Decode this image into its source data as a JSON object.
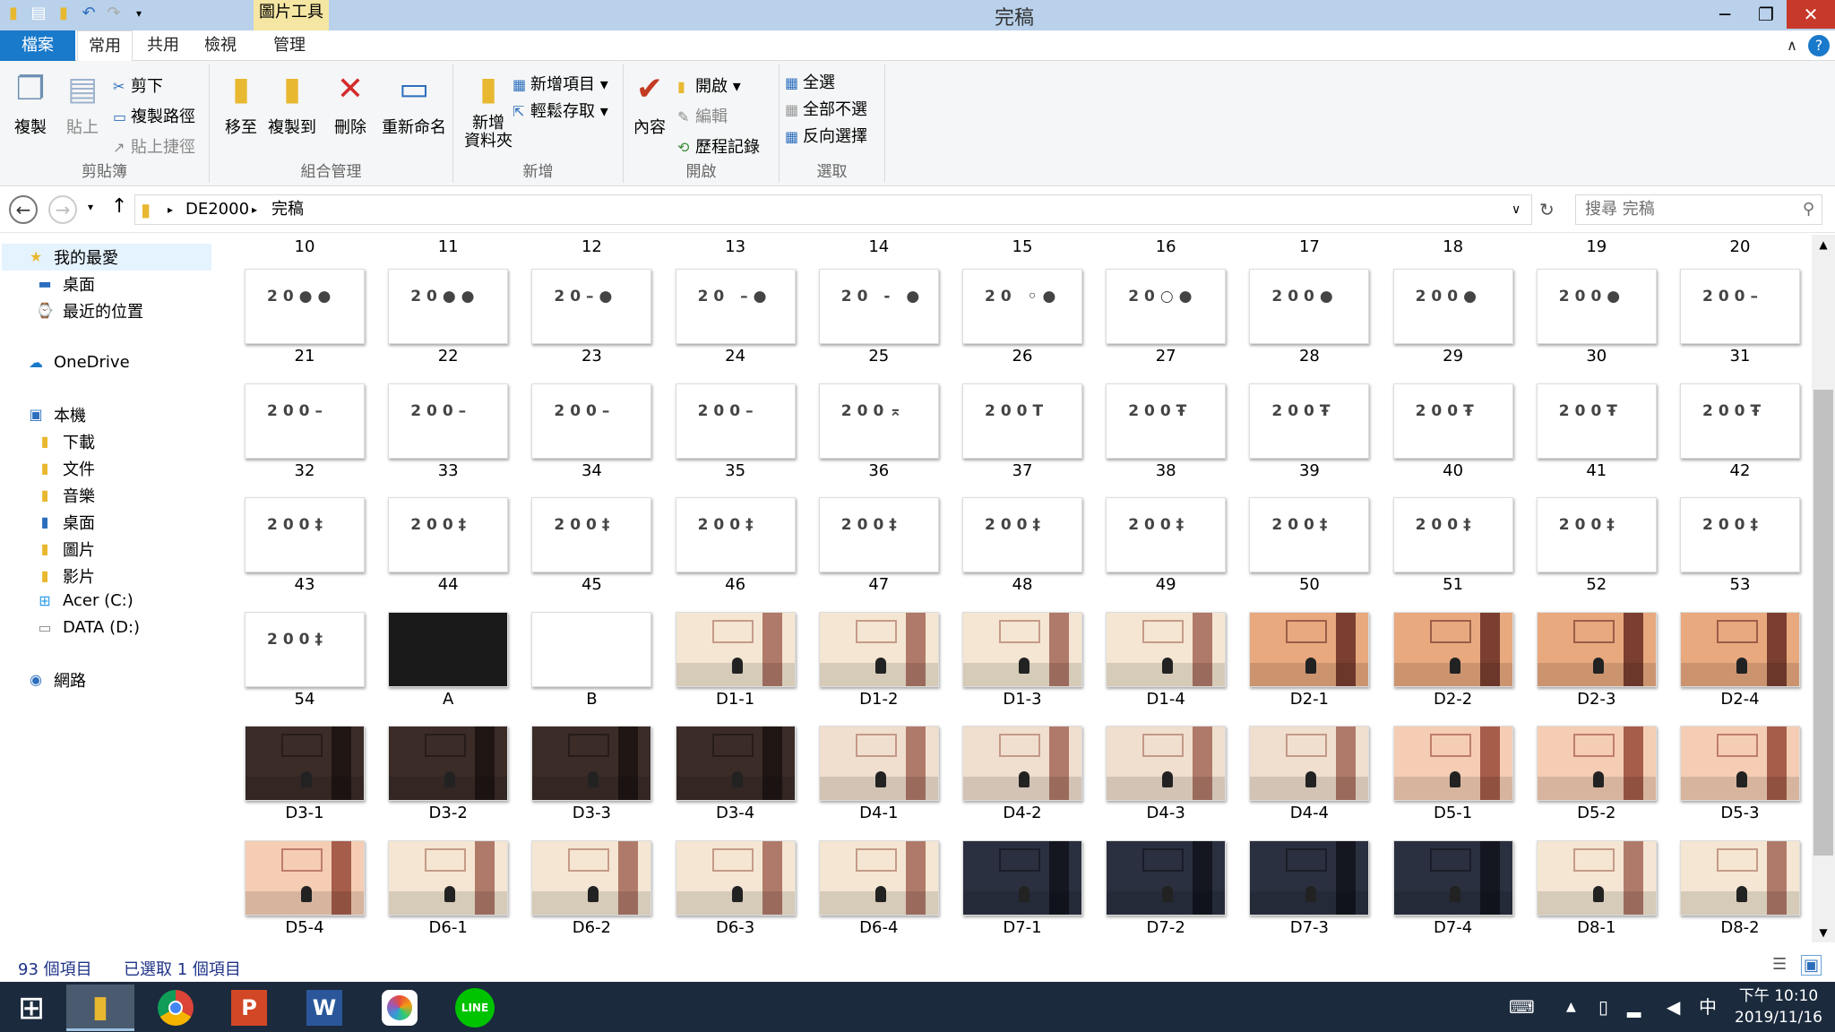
{
  "window": {
    "title": "完稿",
    "context_tab": "圖片工具",
    "min_btn": "─",
    "max_btn": "❐",
    "close_btn": "✕"
  },
  "tabs": {
    "file": "檔案",
    "home": "常用",
    "share": "共用",
    "view": "檢視",
    "manage": "管理"
  },
  "ribbon": {
    "clipboard": {
      "label": "剪貼簿",
      "copy": "複製",
      "paste": "貼上",
      "cut": "剪下",
      "copy_path": "複製路徑",
      "paste_shortcut": "貼上捷徑"
    },
    "organize": {
      "label": "組合管理",
      "move_to": "移至",
      "copy_to": "複製到",
      "delete": "刪除",
      "rename": "重新命名"
    },
    "new": {
      "label": "新增",
      "new_folder_1": "新增",
      "new_folder_2": "資料夾",
      "new_item": "新增項目",
      "easy_access": "輕鬆存取"
    },
    "open": {
      "label": "開啟",
      "properties": "內容",
      "open": "開啟",
      "edit": "編輯",
      "history": "歷程記錄"
    },
    "select": {
      "label": "選取",
      "select_all": "全選",
      "select_none": "全部不選",
      "invert": "反向選擇"
    }
  },
  "address": {
    "crumb1": "DE2000",
    "crumb2": "完稿",
    "search_placeholder": "搜尋 完稿"
  },
  "nav": {
    "favorites": "我的最愛",
    "desktop": "桌面",
    "recent": "最近的位置",
    "onedrive": "OneDrive",
    "thispc": "本機",
    "downloads": "下載",
    "documents": "文件",
    "music": "音樂",
    "desktop2": "桌面",
    "pictures": "圖片",
    "videos": "影片",
    "drive_c": "Acer (C:)",
    "drive_d": "DATA (D:)",
    "network": "網路"
  },
  "files": {
    "top_labels": [
      "10",
      "11",
      "12",
      "13",
      "14",
      "15",
      "16",
      "17",
      "18",
      "19",
      "20"
    ],
    "rows": [
      {
        "labels": [
          "21",
          "22",
          "23",
          "24",
          "25",
          "26",
          "27",
          "28",
          "29",
          "30",
          "31"
        ],
        "thumbs": [
          "20●●",
          "20●●",
          "20–●",
          "20 –●",
          "20 - ●",
          "20 ◦●",
          "20○●",
          "200●",
          "200●",
          "200●",
          "200–"
        ]
      },
      {
        "labels": [
          "32",
          "33",
          "34",
          "35",
          "36",
          "37",
          "38",
          "39",
          "40",
          "41",
          "42"
        ],
        "thumbs": [
          "200–",
          "200–",
          "200–",
          "200–",
          "200⌅",
          "200T",
          "200Ŧ",
          "200Ŧ",
          "200Ŧ",
          "200Ŧ",
          "200Ŧ"
        ]
      },
      {
        "labels": [
          "43",
          "44",
          "45",
          "46",
          "47",
          "48",
          "49",
          "50",
          "51",
          "52",
          "53"
        ],
        "thumbs": [
          "200‡",
          "200‡",
          "200‡",
          "200‡",
          "200‡",
          "200‡",
          "200‡",
          "200‡",
          "200‡",
          "200‡",
          "200‡"
        ]
      },
      {
        "labels": [
          "54",
          "A",
          "B",
          "D1-1",
          "D1-2",
          "D1-3",
          "D1-4",
          "D2-1",
          "D2-2",
          "D2-3",
          "D2-4"
        ],
        "thumbs": [
          "200‡",
          "",
          "",
          "",
          "",
          "",
          "",
          "",
          "",
          "",
          ""
        ]
      },
      {
        "labels": [
          "D3-1",
          "D3-2",
          "D3-3",
          "D3-4",
          "D4-1",
          "D4-2",
          "D4-3",
          "D4-4",
          "D5-1",
          "D5-2",
          "D5-3"
        ],
        "thumbs": [
          "",
          "",
          "",
          "",
          "",
          "",
          "",
          "",
          "",
          "",
          ""
        ]
      },
      {
        "labels": [
          "D5-4",
          "D6-1",
          "D6-2",
          "D6-3",
          "D6-4",
          "D7-1",
          "D7-2",
          "D7-3",
          "D7-4",
          "D8-1",
          "D8-2"
        ],
        "thumbs": [
          "",
          "",
          "",
          "",
          "",
          "",
          "",
          "",
          "",
          "",
          ""
        ]
      }
    ]
  },
  "status": {
    "count": "93 個項目",
    "selected": "已選取 1 個項目"
  },
  "taskbar": {
    "ime": "中",
    "time": "下午 10:10",
    "date": "2019/11/16"
  },
  "colors": {
    "file_tab": "#1979ca",
    "titlebar": "#b9d1ea",
    "taskbar": "#1b2a3d",
    "close": "#c7392b"
  }
}
